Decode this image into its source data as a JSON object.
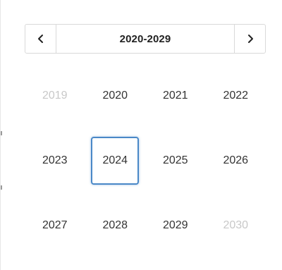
{
  "header": {
    "title": "2020-2029",
    "prev_icon": "chevron-left-icon",
    "next_icon": "chevron-right-icon"
  },
  "years": [
    {
      "label": "2019",
      "state": "outside"
    },
    {
      "label": "2020",
      "state": "normal"
    },
    {
      "label": "2021",
      "state": "normal"
    },
    {
      "label": "2022",
      "state": "normal"
    },
    {
      "label": "2023",
      "state": "normal"
    },
    {
      "label": "2024",
      "state": "selected"
    },
    {
      "label": "2025",
      "state": "normal"
    },
    {
      "label": "2026",
      "state": "normal"
    },
    {
      "label": "2027",
      "state": "normal"
    },
    {
      "label": "2028",
      "state": "normal"
    },
    {
      "label": "2029",
      "state": "normal"
    },
    {
      "label": "2030",
      "state": "outside"
    }
  ],
  "colors": {
    "accent": "#4a88c7",
    "muted_text": "#c8c8c8",
    "text": "#333333",
    "border": "#d9d9d9"
  }
}
